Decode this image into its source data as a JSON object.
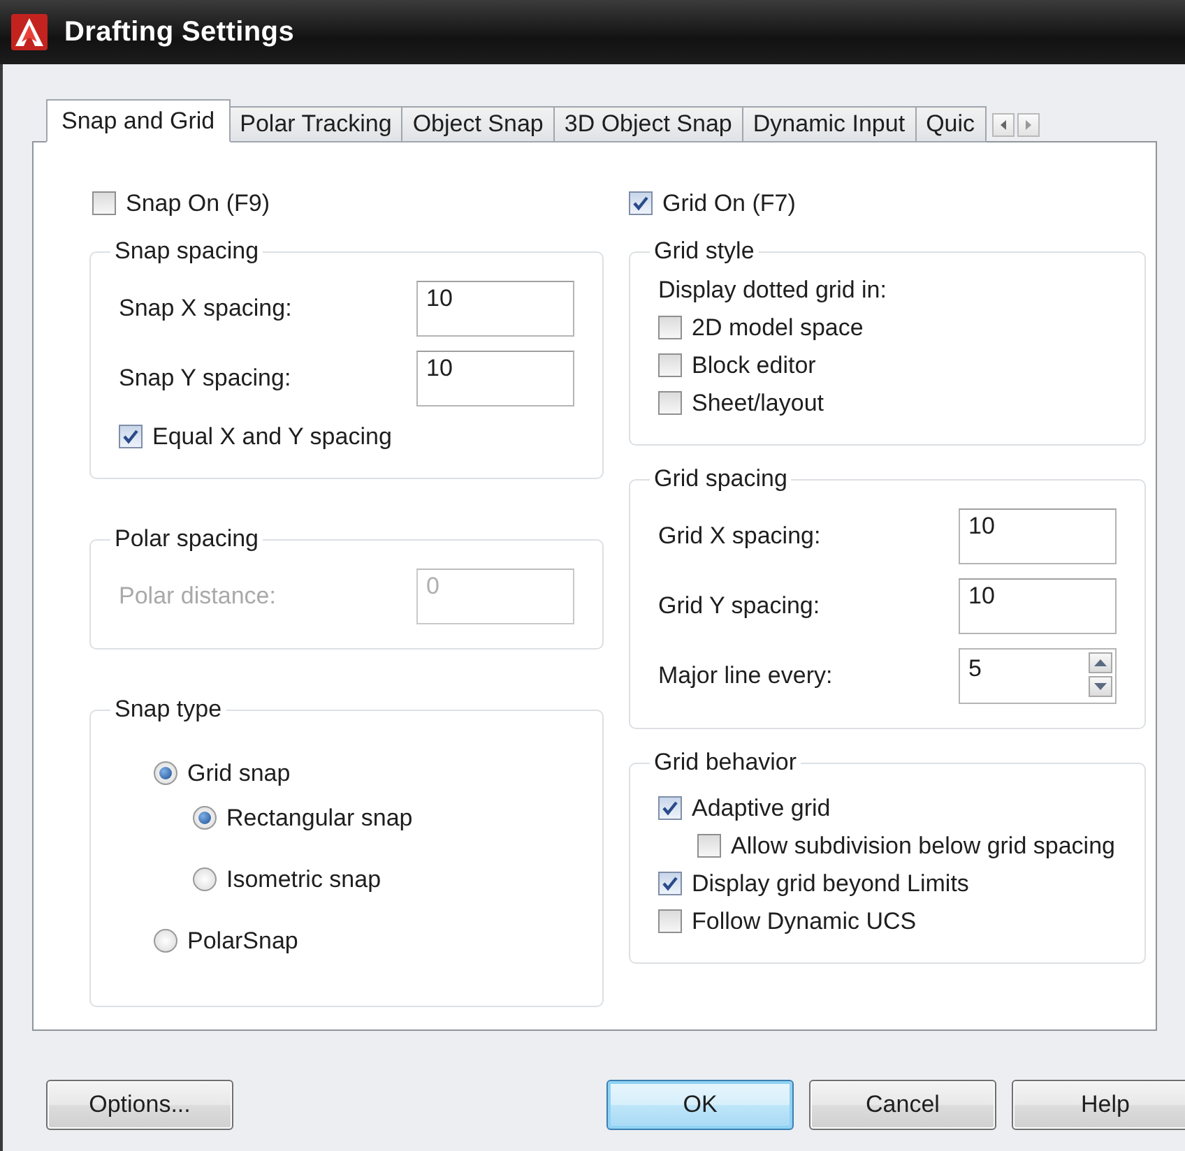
{
  "window": {
    "title": "Drafting Settings"
  },
  "tabs": [
    {
      "label": "Snap and Grid",
      "selected": true
    },
    {
      "label": "Polar Tracking",
      "selected": false
    },
    {
      "label": "Object Snap",
      "selected": false
    },
    {
      "label": "3D Object Snap",
      "selected": false
    },
    {
      "label": "Dynamic Input",
      "selected": false
    },
    {
      "label": "Quic",
      "selected": false
    }
  ],
  "snap_on": {
    "label": "Snap On (F9)",
    "checked": false
  },
  "snap_spacing": {
    "title": "Snap spacing",
    "fields": [
      {
        "label": "Snap X spacing:",
        "value": "10",
        "disabled": false,
        "kind": "text"
      },
      {
        "label": "Snap Y spacing:",
        "value": "10",
        "disabled": false,
        "kind": "text"
      }
    ],
    "options": [
      {
        "label": "Equal X and Y spacing",
        "checked": true
      }
    ]
  },
  "polar_spacing": {
    "title": "Polar spacing",
    "fields": [
      {
        "label": "Polar distance:",
        "value": "0",
        "disabled": true,
        "kind": "text"
      }
    ]
  },
  "snap_type": {
    "title": "Snap type",
    "options": [
      {
        "label": "Grid snap",
        "selected": true,
        "children": [
          {
            "label": "Rectangular snap",
            "selected": true
          },
          {
            "label": "Isometric snap",
            "selected": false
          }
        ]
      },
      {
        "label": "PolarSnap",
        "selected": false
      }
    ]
  },
  "grid_on": {
    "label": "Grid On (F7)",
    "checked": true
  },
  "grid_style": {
    "title": "Grid style",
    "caption": "Display dotted grid in:",
    "options": [
      {
        "label": "2D model space",
        "checked": false
      },
      {
        "label": "Block editor",
        "checked": false
      },
      {
        "label": "Sheet/layout",
        "checked": false
      }
    ]
  },
  "grid_spacing": {
    "title": "Grid spacing",
    "fields": [
      {
        "label": "Grid X spacing:",
        "value": "10",
        "disabled": false,
        "kind": "text"
      },
      {
        "label": "Grid Y spacing:",
        "value": "10",
        "disabled": false,
        "kind": "text"
      },
      {
        "label": "Major line every:",
        "value": "5",
        "disabled": false,
        "kind": "spinner"
      }
    ]
  },
  "grid_behavior": {
    "title": "Grid behavior",
    "options": [
      {
        "label": "Adaptive grid",
        "checked": true,
        "children": [
          {
            "label": "Allow subdivision below grid spacing",
            "checked": false
          }
        ]
      },
      {
        "label": "Display grid beyond Limits",
        "checked": true
      },
      {
        "label": "Follow Dynamic UCS",
        "checked": false
      }
    ]
  },
  "buttons": [
    {
      "label": "Options...",
      "default": false
    },
    {
      "label": "OK",
      "default": true
    },
    {
      "label": "Cancel",
      "default": false
    },
    {
      "label": "Help",
      "default": false
    }
  ]
}
